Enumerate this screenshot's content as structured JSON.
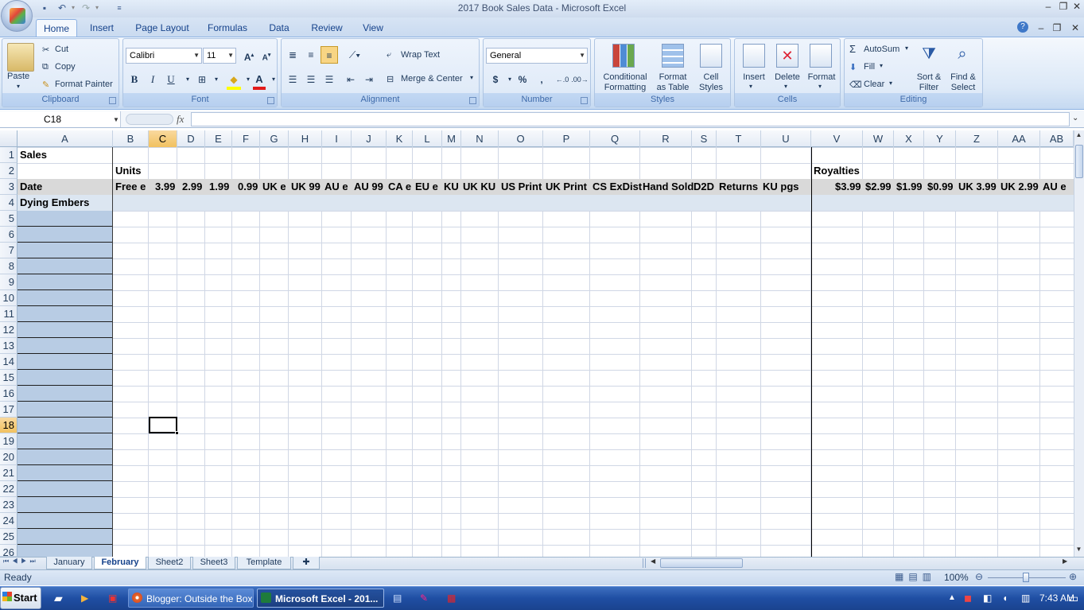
{
  "window": {
    "title": "2017 Book Sales Data - Microsoft Excel"
  },
  "qat": {
    "save_icon": "save-icon",
    "undo_icon": "undo-icon",
    "redo_icon": "redo-icon"
  },
  "ribbon_tabs": [
    "Home",
    "Insert",
    "Page Layout",
    "Formulas",
    "Data",
    "Review",
    "View"
  ],
  "clipboard": {
    "paste": "Paste",
    "cut": "Cut",
    "copy": "Copy",
    "format_painter": "Format Painter",
    "label": "Clipboard"
  },
  "font": {
    "name": "Calibri",
    "size": "11",
    "label": "Font",
    "bold": "B",
    "italic": "I",
    "underline": "U"
  },
  "alignment": {
    "wrap_text": "Wrap Text",
    "merge_center": "Merge & Center",
    "label": "Alignment"
  },
  "number": {
    "format": "General",
    "currency": "$",
    "percent": "%",
    "comma": ",",
    "label": "Number"
  },
  "styles": {
    "conditional": "Conditional",
    "conditional2": "Formatting",
    "format_as": "Format",
    "format_as2": "as Table",
    "cell": "Cell",
    "cell2": "Styles",
    "label": "Styles"
  },
  "cells": {
    "insert": "Insert",
    "delete": "Delete",
    "format": "Format",
    "label": "Cells"
  },
  "editing": {
    "autosum": "AutoSum",
    "fill": "Fill",
    "clear": "Clear",
    "sort": "Sort &",
    "sort2": "Filter",
    "find": "Find &",
    "find2": "Select",
    "label": "Editing"
  },
  "formula_bar": {
    "name_box": "C18",
    "fx": "fx",
    "value": ""
  },
  "columns": [
    "A",
    "B",
    "C",
    "D",
    "E",
    "F",
    "G",
    "H",
    "I",
    "J",
    "K",
    "L",
    "M",
    "N",
    "O",
    "P",
    "Q",
    "R",
    "S",
    "T",
    "U",
    "V",
    "W",
    "X",
    "Y",
    "Z",
    "AA",
    "AB"
  ],
  "rows": [
    "1",
    "2",
    "3",
    "4",
    "5",
    "6",
    "7",
    "8",
    "9",
    "10",
    "11",
    "12",
    "13",
    "14",
    "15",
    "16",
    "17",
    "18",
    "19",
    "20",
    "21",
    "22",
    "23",
    "24",
    "25",
    "26"
  ],
  "cells_content": {
    "A1": "Sales",
    "B2": "Units",
    "V2": "Royalties",
    "A3": "Date",
    "A4": "Dying Embers",
    "row3": [
      "Free e",
      "3.99",
      "2.99",
      "1.99",
      "0.99",
      "UK e",
      "UK 99",
      "AU e",
      "AU 99",
      "CA e",
      "EU e",
      "KU",
      "UK KU",
      "US Print",
      "UK Print",
      "CS ExDist",
      "Hand Sold",
      "D2D",
      "Returns",
      "KU pgs"
    ],
    "row3_royalties": [
      "$3.99",
      "$2.99",
      "$1.99",
      "$0.99",
      "UK 3.99",
      "UK 2.99",
      "AU e"
    ]
  },
  "sheets": [
    "January",
    "February",
    "Sheet2",
    "Sheet3",
    "Template"
  ],
  "status": {
    "ready": "Ready",
    "zoom": "100%"
  },
  "taskbar": {
    "start": "Start",
    "items": [
      "Blogger: Outside the Box...",
      "Microsoft Excel - 201..."
    ],
    "time": "7:43 AM"
  },
  "colors": {
    "selection_fill": "#b8cce4",
    "header_highlight": "#f1c15f",
    "ribbon_bg": "#dbe8f7"
  }
}
